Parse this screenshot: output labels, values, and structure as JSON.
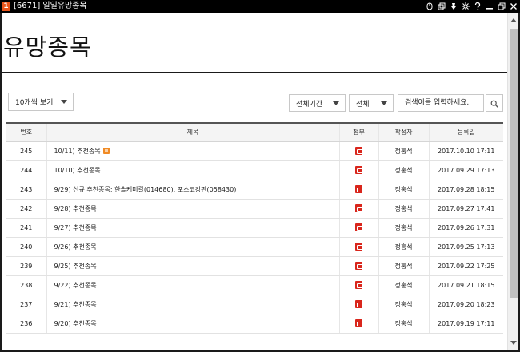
{
  "window": {
    "badge": "1",
    "title": "[6671] 일일유망종목",
    "icons": [
      "mouse-icon",
      "copy-icon",
      "pin-icon",
      "settings-icon",
      "help-icon",
      "minimize-icon",
      "restore-icon",
      "close-icon"
    ]
  },
  "page": {
    "title": "유망종목"
  },
  "toolbar": {
    "per_page": "10개씩 보기",
    "period": "전체기간",
    "scope": "전체",
    "search_placeholder": "검색어를 입력하세요.",
    "search_icon": "search-icon"
  },
  "table": {
    "headers": [
      "번호",
      "제목",
      "첨부",
      "작성자",
      "등록일"
    ],
    "rows": [
      {
        "num": "245",
        "title": "10/11) 추천종목",
        "new": true,
        "attachment": "pdf-icon",
        "author": "정홍석",
        "date": "2017.10.10 17:11"
      },
      {
        "num": "244",
        "title": "10/10) 추천종목",
        "new": false,
        "attachment": "pdf-icon",
        "author": "정홍석",
        "date": "2017.09.29 17:13"
      },
      {
        "num": "243",
        "title": "9/29) 신규 추천종목; 한솔케미칼(014680), 포스코강판(058430)",
        "new": false,
        "attachment": "pdf-icon",
        "author": "정홍석",
        "date": "2017.09.28 18:15"
      },
      {
        "num": "242",
        "title": "9/28) 추천종목",
        "new": false,
        "attachment": "pdf-icon",
        "author": "정홍석",
        "date": "2017.09.27 17:41"
      },
      {
        "num": "241",
        "title": "9/27) 추천종목",
        "new": false,
        "attachment": "pdf-icon",
        "author": "정홍석",
        "date": "2017.09.26 17:31"
      },
      {
        "num": "240",
        "title": "9/26) 추천종목",
        "new": false,
        "attachment": "pdf-icon",
        "author": "정홍석",
        "date": "2017.09.25 17:13"
      },
      {
        "num": "239",
        "title": "9/25) 추천종목",
        "new": false,
        "attachment": "pdf-icon",
        "author": "정홍석",
        "date": "2017.09.22 17:25"
      },
      {
        "num": "238",
        "title": "9/22) 추천종목",
        "new": false,
        "attachment": "pdf-icon",
        "author": "정홍석",
        "date": "2017.09.21 18:15"
      },
      {
        "num": "237",
        "title": "9/21) 추천종목",
        "new": false,
        "attachment": "pdf-icon",
        "author": "정홍석",
        "date": "2017.09.20 18:23"
      },
      {
        "num": "236",
        "title": "9/20) 추천종목",
        "new": false,
        "attachment": "pdf-icon",
        "author": "정홍석",
        "date": "2017.09.19 17:11"
      }
    ]
  },
  "colors": {
    "badge": "#e8541a",
    "pdf": "#d9261c",
    "new_badge": "#f08a24",
    "title_bar": "#000000"
  }
}
